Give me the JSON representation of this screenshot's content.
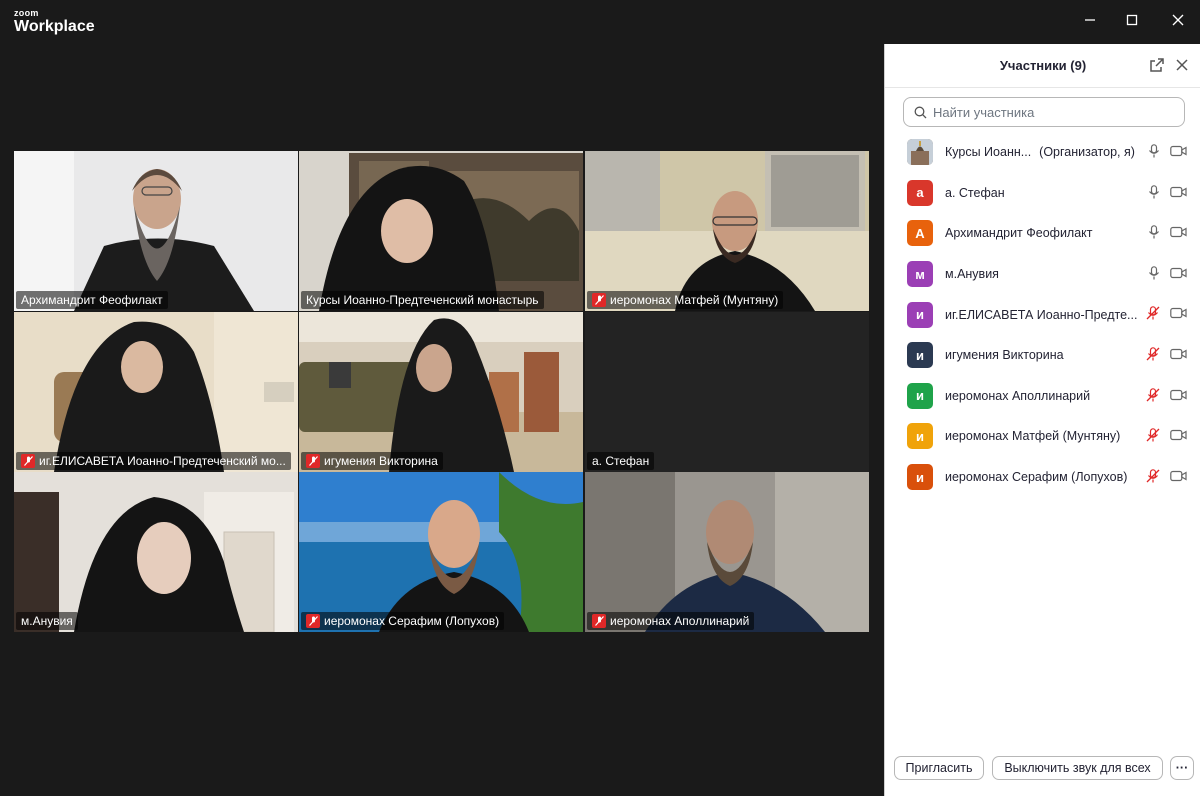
{
  "app": {
    "brand_small": "zoom",
    "brand_big": "Workplace"
  },
  "window_controls": [
    "minimize-icon",
    "maximize-icon",
    "close-icon"
  ],
  "colors": {
    "active_speaker": "#3ecf8e",
    "mute_red": "#e02828",
    "panel_bg": "#ffffff",
    "stage_bg": "#1a1a1a"
  },
  "tiles": [
    {
      "name": "Архимандрит Феофилакт",
      "muted": false,
      "active": false
    },
    {
      "name": "Курсы Иоанно-Предтеченский монастырь",
      "muted": false,
      "active": true
    },
    {
      "name": "иеромонах Матфей (Мунтяну)",
      "muted": true,
      "active": false
    },
    {
      "name": "иг.ЕЛИСАВЕТА Иоанно-Предтеченский мо...",
      "muted": true,
      "active": false
    },
    {
      "name": "игумения Викторина",
      "muted": true,
      "active": false
    },
    {
      "name": "а. Стефан",
      "muted": false,
      "active": false
    },
    {
      "name": "м.Анувия",
      "muted": false,
      "active": false
    },
    {
      "name": "иеромонах Серафим (Лопухов)",
      "muted": true,
      "active": false
    },
    {
      "name": "иеромонах Аполлинарий",
      "muted": true,
      "active": false
    }
  ],
  "panel": {
    "title": "Участники (9)",
    "search_placeholder": "Найти участника",
    "participants": [
      {
        "initial": "",
        "avatar_color": "#8a7a6a",
        "name": "Курсы Иоанн...",
        "role": "(Организатор, я)",
        "muted": false
      },
      {
        "initial": "а",
        "avatar_color": "#d9372b",
        "name": "а. Стефан",
        "role": "",
        "muted": false
      },
      {
        "initial": "А",
        "avatar_color": "#e8620c",
        "name": "Архимандрит Феофилакт",
        "role": "",
        "muted": false
      },
      {
        "initial": "м",
        "avatar_color": "#9b3fb5",
        "name": "м.Анувия",
        "role": "",
        "muted": false
      },
      {
        "initial": "и",
        "avatar_color": "#9b3fb5",
        "name": "иг.ЕЛИСАВЕТА Иоанно-Предте...",
        "role": "",
        "muted": true
      },
      {
        "initial": "и",
        "avatar_color": "#2b3a52",
        "name": "игумения Викторина",
        "role": "",
        "muted": true
      },
      {
        "initial": "и",
        "avatar_color": "#1fa34a",
        "name": "иеромонах Аполлинарий",
        "role": "",
        "muted": true
      },
      {
        "initial": "и",
        "avatar_color": "#f0a30a",
        "name": "иеромонах Матфей (Мунтяну)",
        "role": "",
        "muted": true
      },
      {
        "initial": "и",
        "avatar_color": "#d9500b",
        "name": "иеромонах Серафим (Лопухов)",
        "role": "",
        "muted": true
      }
    ],
    "invite_label": "Пригласить",
    "mute_all_label": "Выключить звук для всех",
    "more_label": "···"
  }
}
